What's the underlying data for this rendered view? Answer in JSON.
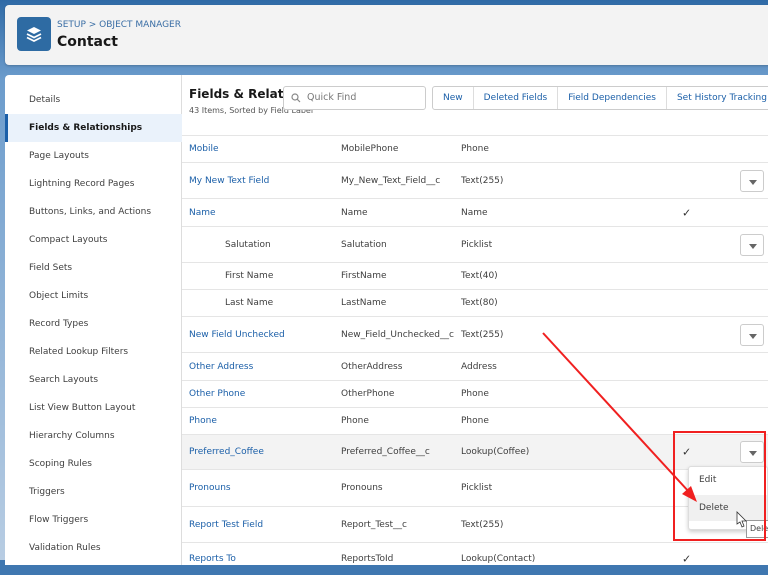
{
  "header": {
    "breadcrumb": "SETUP > OBJECT MANAGER",
    "title": "Contact",
    "icon": "layers-icon"
  },
  "sidebar": {
    "items": [
      {
        "label": "Details"
      },
      {
        "label": "Fields & Relationships",
        "selected": true
      },
      {
        "label": "Page Layouts"
      },
      {
        "label": "Lightning Record Pages"
      },
      {
        "label": "Buttons, Links, and Actions"
      },
      {
        "label": "Compact Layouts"
      },
      {
        "label": "Field Sets"
      },
      {
        "label": "Object Limits"
      },
      {
        "label": "Record Types"
      },
      {
        "label": "Related Lookup Filters"
      },
      {
        "label": "Search Layouts"
      },
      {
        "label": "List View Button Layout"
      },
      {
        "label": "Hierarchy Columns"
      },
      {
        "label": "Scoping Rules"
      },
      {
        "label": "Triggers"
      },
      {
        "label": "Flow Triggers"
      },
      {
        "label": "Validation Rules"
      }
    ]
  },
  "main": {
    "title": "Fields & Relationships",
    "subtitle": "43 Items, Sorted by Field Label",
    "search_placeholder": "Quick Find",
    "buttons": [
      "New",
      "Deleted Fields",
      "Field Dependencies",
      "Set History Tracking"
    ],
    "rows": [
      {
        "label": "Mobile",
        "api": "MobilePhone",
        "type": "Phone",
        "indexed": false,
        "menu": false
      },
      {
        "label": "My New Text Field",
        "api": "My_New_Text_Field__c",
        "type": "Text(255)",
        "indexed": false,
        "menu": true
      },
      {
        "label": "Name",
        "api": "Name",
        "type": "Name",
        "indexed": true,
        "menu": false
      },
      {
        "label": "Salutation",
        "api": "Salutation",
        "type": "Picklist",
        "indexed": false,
        "menu": true,
        "sub": true
      },
      {
        "label": "First Name",
        "api": "FirstName",
        "type": "Text(40)",
        "indexed": false,
        "menu": false,
        "sub": true
      },
      {
        "label": "Last Name",
        "api": "LastName",
        "type": "Text(80)",
        "indexed": false,
        "menu": false,
        "sub": true
      },
      {
        "label": "New Field Unchecked",
        "api": "New_Field_Unchecked__c",
        "type": "Text(255)",
        "indexed": false,
        "menu": true
      },
      {
        "label": "Other Address",
        "api": "OtherAddress",
        "type": "Address",
        "indexed": false,
        "menu": false
      },
      {
        "label": "Other Phone",
        "api": "OtherPhone",
        "type": "Phone",
        "indexed": false,
        "menu": false
      },
      {
        "label": "Phone",
        "api": "Phone",
        "type": "Phone",
        "indexed": false,
        "menu": false
      },
      {
        "label": "Preferred_Coffee",
        "api": "Preferred_Coffee__c",
        "type": "Lookup(Coffee)",
        "indexed": true,
        "menu": true,
        "highlight": true
      },
      {
        "label": "Pronouns",
        "api": "Pronouns",
        "type": "Picklist",
        "indexed": false,
        "menu": false
      },
      {
        "label": "Report Test Field",
        "api": "Report_Test__c",
        "type": "Text(255)",
        "indexed": false,
        "menu": false
      },
      {
        "label": "Reports To",
        "api": "ReportsToId",
        "type": "Lookup(Contact)",
        "indexed": true,
        "menu": false
      }
    ]
  },
  "menu": {
    "items": [
      "Edit",
      "Delete"
    ],
    "tooltip": "Dele"
  },
  "colors": {
    "link": "#1b5fa8",
    "annotation": "#f02020",
    "brand": "#2e6ba3"
  }
}
